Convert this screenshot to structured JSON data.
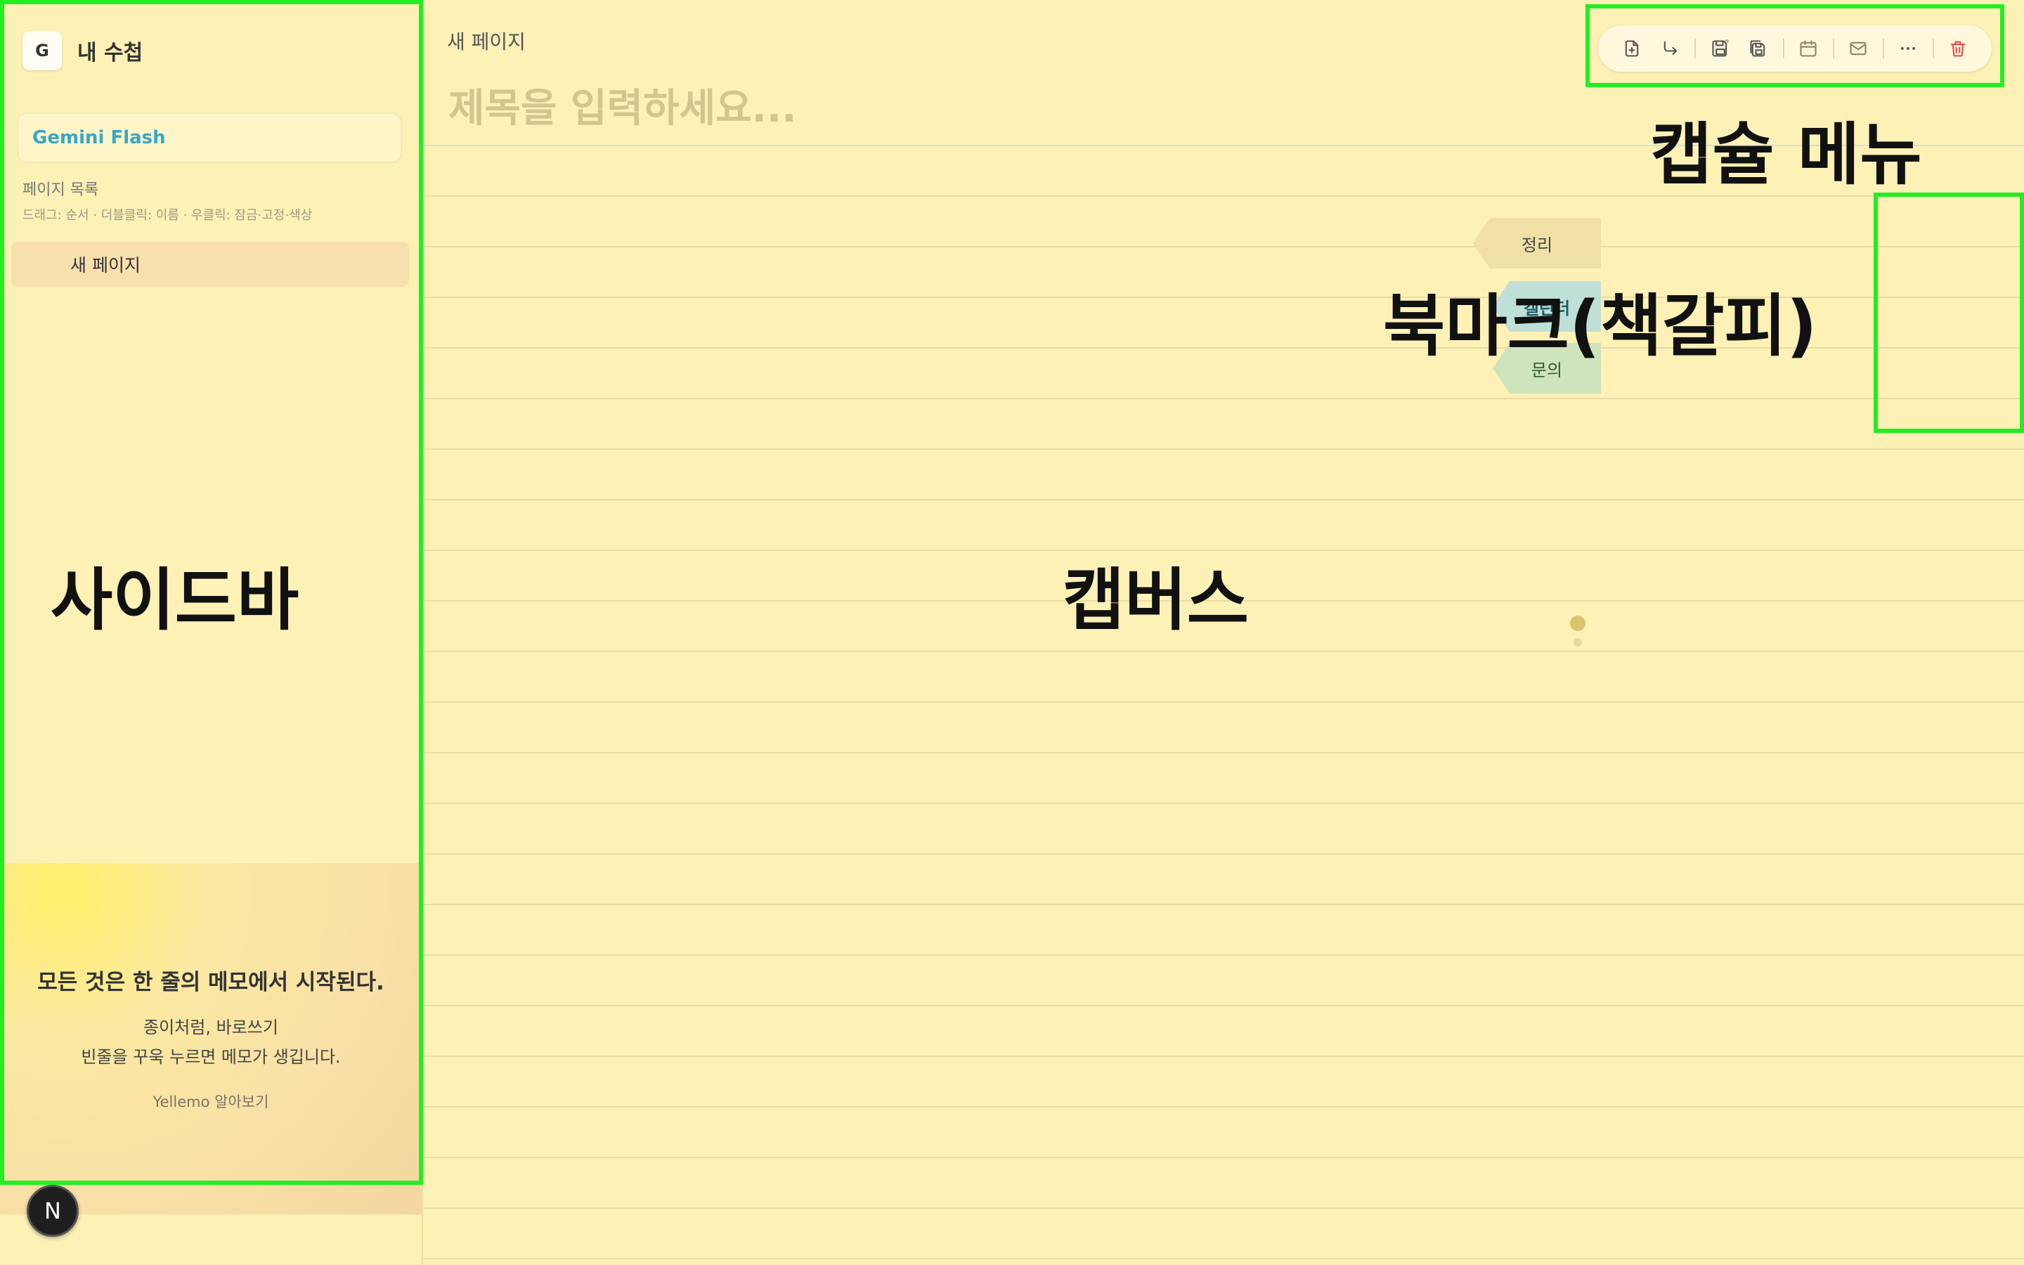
{
  "sidebar": {
    "notebook_icon_letter": "G",
    "notebook_title": "내 수첩",
    "model_name": "Gemini Flash",
    "pages_title": "페이지 목록",
    "pages_hint": "드래그: 순서 · 더블클릭: 이름 · 우클릭: 잠금·고정·색상",
    "pages": [
      {
        "label": "새 페이지"
      }
    ],
    "promo": {
      "headline": "모든 것은 한 줄의 메모에서 시작된다.",
      "line1": "종이처럼, 바로쓰기",
      "line2": "빈줄을 꾸욱 누르면 메모가 생깁니다.",
      "link": "Yellemo 알아보기"
    },
    "badge_letter": "N"
  },
  "canvas": {
    "breadcrumb": "새 페이지",
    "title_placeholder": "제목을 입력하세요...",
    "title_value": ""
  },
  "capsule_menu": {
    "buttons": [
      {
        "icon": "new-page-icon"
      },
      {
        "icon": "redirect-arrow-icon"
      },
      {
        "icon": "save-icon"
      },
      {
        "icon": "save-all-icon"
      },
      {
        "icon": "calendar-icon"
      },
      {
        "icon": "mail-icon"
      },
      {
        "icon": "more-icon"
      },
      {
        "icon": "trash-icon"
      }
    ]
  },
  "bookmarks": [
    {
      "label": "정리",
      "color": "#f0e0a6"
    },
    {
      "label": "캘린더",
      "color": "#bfe0d6"
    },
    {
      "label": "문의",
      "color": "#cfe3bd"
    }
  ],
  "annotations": {
    "sidebar": "사이드바",
    "canvas": "캡버스",
    "bookmark": "북마크(책갈피)",
    "capsule": "캡슐 메뉴",
    "highlight_color": "#22ee22"
  },
  "colors": {
    "paper": "#fdf1b6",
    "accent": "#3aa6c8",
    "danger": "#e04a4a"
  }
}
